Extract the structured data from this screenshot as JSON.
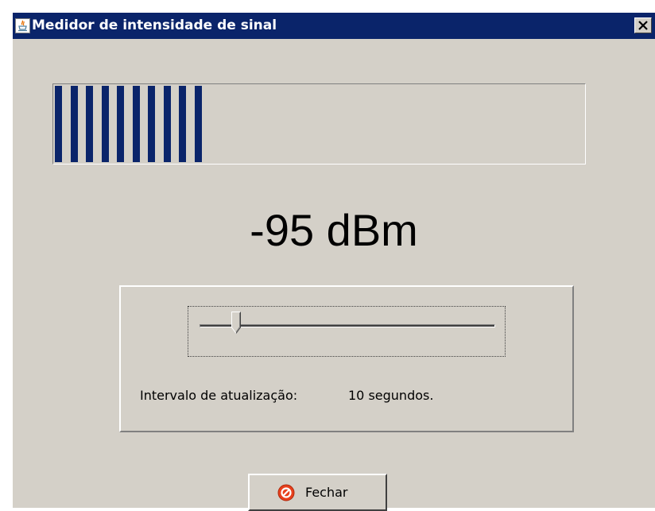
{
  "window": {
    "title": "Medidor de intensidade de sinal",
    "icon": "java-icon"
  },
  "meter": {
    "active_segments": 10,
    "color": "#0a246a"
  },
  "signal": {
    "value_text": "-95 dBm"
  },
  "slider": {
    "label": "Intervalo de atualização:",
    "value_text": "10 segundos."
  },
  "buttons": {
    "close_label": "Fechar",
    "close_icon": "stop-icon"
  }
}
